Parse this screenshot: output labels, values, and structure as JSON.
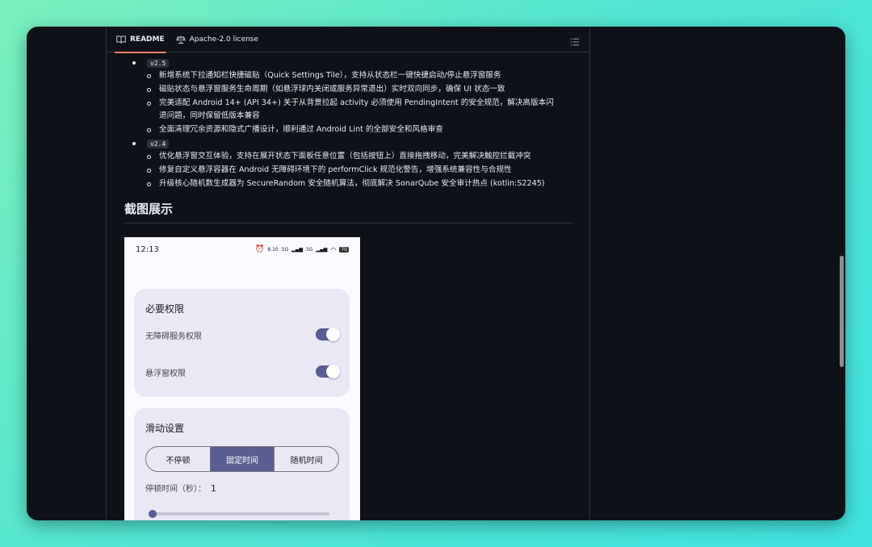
{
  "tabs": [
    {
      "label": "README",
      "icon": "book-icon"
    },
    {
      "label": "Apache-2.0 license",
      "icon": "scale-icon"
    }
  ],
  "releases": [
    {
      "version": "v2.5",
      "items": [
        "新增系统下拉通知栏快捷磁贴（Quick Settings Tile），支持从状态栏一键快捷启动/停止悬浮窗服务",
        "磁贴状态与悬浮窗服务生命周期（如悬浮球内关闭或服务异常退出）实时双向同步，确保 UI 状态一致",
        "完美适配 Android 14+ (API 34+) 关于从背景拉起 activity 必须使用 PendingIntent 的安全规范，解决高版本闪",
        "全面清理冗余资源和隐式广播设计，顺利通过 Android Lint 的全部安全和风格审查"
      ],
      "item3_cont": "退问题，同时保留低版本兼容"
    },
    {
      "version": "v2.4",
      "items": [
        "优化悬浮窗交互体验，支持在展开状态下面板任意位置（包括按钮上）直接拖拽移动，完美解决触控拦截冲突",
        "修复自定义悬浮容器在 Android 无障碍环境下的 performClick 规范化警告，增强系统兼容性与合规性",
        "升级核心随机数生成器为 SecureRandom 安全随机算法，彻底解决 SonarQube 安全审计热点 (kotlin:S2245)"
      ]
    }
  ],
  "section_title": "截图展示",
  "phone": {
    "time": "12:13",
    "status_speed": "8.10",
    "status_unit": "KB/s",
    "status_sig1": "5G",
    "status_sig2": "5G",
    "battery": "70",
    "permissions_card": {
      "title": "必要权限",
      "items": [
        {
          "label": "无障碍服务权限",
          "on": true
        },
        {
          "label": "悬浮窗权限",
          "on": true
        }
      ]
    },
    "swipe_card": {
      "title": "滑动设置",
      "options": [
        "不停顿",
        "固定时间",
        "随机时间"
      ],
      "selected": "固定时间",
      "stay_label": "停顿时间（秒）：",
      "stay_value": "1",
      "slider_value": 0.0
    }
  },
  "colors": {
    "bg": "#0e1117",
    "accent": "#5a5d91",
    "tab_underline": "#f78166"
  }
}
